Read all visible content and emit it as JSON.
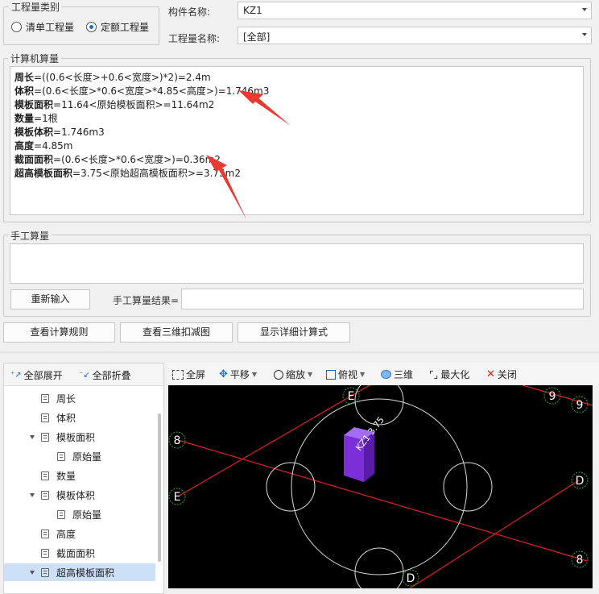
{
  "qty_type": {
    "legend": "工程量类别",
    "options": [
      {
        "label": "清单工程量",
        "selected": false
      },
      {
        "label": "定额工程量",
        "selected": true
      }
    ]
  },
  "component": {
    "label": "构件名称:",
    "value": "KZ1"
  },
  "qty_name": {
    "label": "工程量名称:",
    "value": "[全部]"
  },
  "computer_calc": {
    "legend": "计算机算量",
    "lines": [
      {
        "name": "周长",
        "expr": "=((0.6<长度>+0.6<宽度>)*2)=2.4m"
      },
      {
        "name": "体积",
        "expr": "=(0.6<长度>*0.6<宽度>*4.85<高度>)=1.746m3"
      },
      {
        "name": "模板面积",
        "expr": "=11.64<原始模板面积>=11.64m2"
      },
      {
        "name": "数量",
        "expr": "=1根"
      },
      {
        "name": "模板体积",
        "expr": "=1.746m3"
      },
      {
        "name": "高度",
        "expr": "=4.85m"
      },
      {
        "name": "截面面积",
        "expr": "=(0.6<长度>*0.6<宽度>)=0.36m2"
      },
      {
        "name": "超高模板面积",
        "expr": "=3.75<原始超高模板面积>=3.75m2"
      }
    ]
  },
  "manual_calc": {
    "legend": "手工算量",
    "reinput": "重新输入",
    "result_label": "手工算量结果=",
    "result_value": ""
  },
  "actions": {
    "rules": "查看计算规则",
    "view3d": "查看三维扣减图",
    "detail": "显示详细计算式"
  },
  "tree_toolbar": {
    "expand": "全部展开",
    "collapse": "全部折叠"
  },
  "tree_items": [
    {
      "label": "周长",
      "indent": 1,
      "expandable": false,
      "selected": false
    },
    {
      "label": "体积",
      "indent": 1,
      "expandable": false,
      "selected": false
    },
    {
      "label": "模板面积",
      "indent": 1,
      "expandable": true,
      "selected": false
    },
    {
      "label": "原始量",
      "indent": 2,
      "expandable": false,
      "selected": false
    },
    {
      "label": "数量",
      "indent": 1,
      "expandable": false,
      "selected": false
    },
    {
      "label": "模板体积",
      "indent": 1,
      "expandable": true,
      "selected": false
    },
    {
      "label": "原始量",
      "indent": 2,
      "expandable": false,
      "selected": false
    },
    {
      "label": "高度",
      "indent": 1,
      "expandable": false,
      "selected": false
    },
    {
      "label": "截面面积",
      "indent": 1,
      "expandable": false,
      "selected": false
    },
    {
      "label": "超高模板面积",
      "indent": 1,
      "expandable": true,
      "selected": true
    }
  ],
  "view_toolbar": {
    "fullscreen": "全屏",
    "pan": "平移",
    "zoom": "缩放",
    "top": "俯视",
    "threed": "三维",
    "maximize": "最大化",
    "close": "关闭"
  },
  "viewport": {
    "axis_labels": [
      "E",
      "9",
      "9",
      "8",
      "E",
      "D",
      "8",
      "D"
    ],
    "column_label": "KZ1 3.75",
    "colors": {
      "background": "#000000",
      "grid_line": "#e02020",
      "circle": "#dcdcdc",
      "column": "#7a2fd8",
      "axis_ring": "#2fa83a"
    }
  }
}
